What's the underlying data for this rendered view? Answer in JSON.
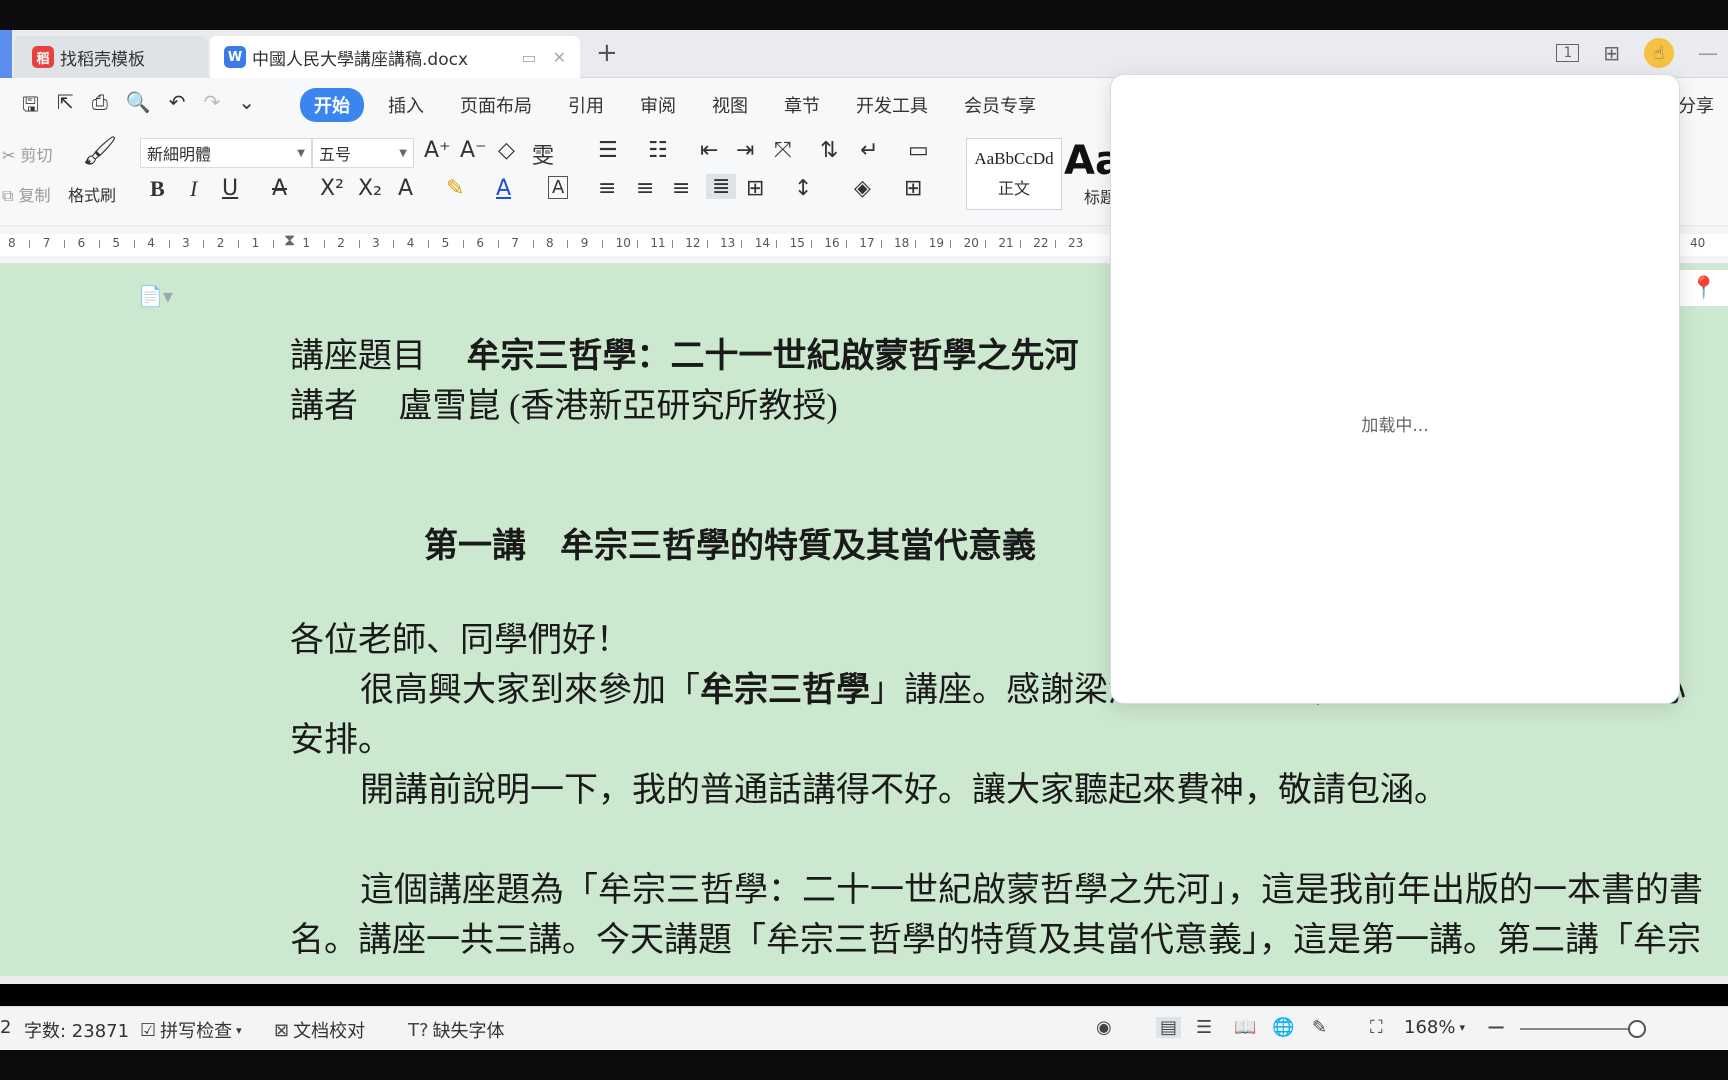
{
  "tabs": [
    {
      "label": "找稻壳模板",
      "icon": "wps-docer-icon"
    },
    {
      "label": "中國人民大學講座講稿.docx",
      "icon": "wps-writer-icon"
    }
  ],
  "menu": {
    "items": [
      "开始",
      "插入",
      "页面布局",
      "引用",
      "审阅",
      "视图",
      "章节",
      "开发工具",
      "会员专享"
    ],
    "active": "开始",
    "share": "分享"
  },
  "ribbon": {
    "cut": "剪切",
    "copy": "复制",
    "format_painter": "格式刷",
    "font_name": "新細明體",
    "font_size": "五号",
    "style_sample": "AaBbCcDd",
    "style_normal": "正文",
    "style_heading_sample": "Aa",
    "style_heading": "标题"
  },
  "ruler": {
    "numbers": [
      "8",
      "7",
      "6",
      "5",
      "4",
      "3",
      "2",
      "1",
      "1",
      "2",
      "3",
      "4",
      "5",
      "6",
      "7",
      "8",
      "9",
      "10",
      "11",
      "12",
      "13",
      "14",
      "15",
      "16",
      "17",
      "18",
      "19",
      "20",
      "21",
      "22",
      "23"
    ],
    "right_number": "40"
  },
  "document": {
    "title_label": "講座題目",
    "title_text": "牟宗三哲學：二十一世紀啟蒙哲學之先河",
    "speaker_label": "講者",
    "speaker_text": "盧雪崑 (香港新亞研究所教授)",
    "lecture_heading": "第一講　牟宗三哲學的特質及其當代意義",
    "greeting": "各位老師、同學們好！",
    "p1_line1_a": "很高興大家到來參加「",
    "p1_line1_b": "牟宗三哲學",
    "p1_line1_c": "」講座。感謝梁濤先生的邀請，以及林光華老師的費心",
    "p1_line2": "安排。",
    "p2": "開講前說明一下，我的普通話講得不好。讓大家聽起來費神，敬請包涵。",
    "p3_line1": "這個講座題為「牟宗三哲學：二十一世紀啟蒙哲學之先河」，這是我前年出版的一本書的書",
    "p3_line2": "名。講座一共三講。今天講題「牟宗三哲學的特質及其當代意義」，這是第一講。第二講「牟宗"
  },
  "popup": {
    "loading": "加载中..."
  },
  "status": {
    "page": "2",
    "word_count": "字数: 23871",
    "spell_check": "拼写检查",
    "doc_proof": "文档校对",
    "missing_font": "缺失字体",
    "zoom": "168%"
  }
}
